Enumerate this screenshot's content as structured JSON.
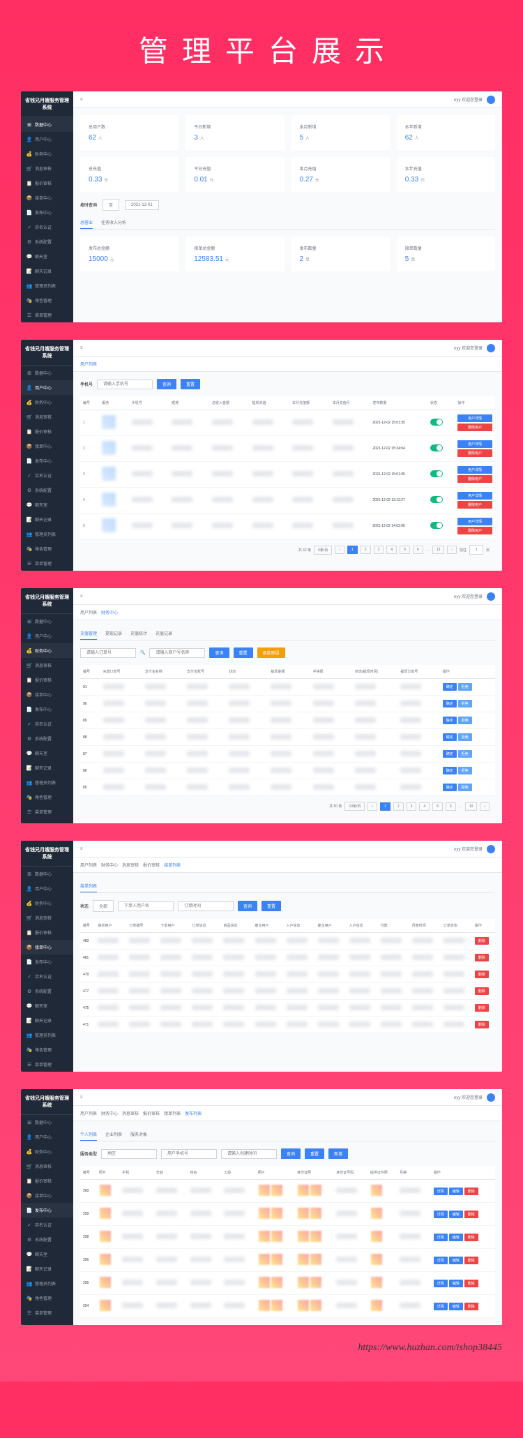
{
  "page_title": "管理平台展示",
  "app_title": "省钱兄月嫂服务管理系统",
  "welcome": "nyy 欢迎您登录",
  "menu_toggle": "≡",
  "sidebar": {
    "items": [
      {
        "icon": "⊞",
        "label": "数据中心"
      },
      {
        "icon": "👤",
        "label": "用户中心"
      },
      {
        "icon": "💰",
        "label": "财务中心"
      },
      {
        "icon": "🛒",
        "label": "消息审核"
      },
      {
        "icon": "📋",
        "label": "报价审核"
      },
      {
        "icon": "📦",
        "label": "接单中心"
      },
      {
        "icon": "📄",
        "label": "发布中心"
      },
      {
        "icon": "✓",
        "label": "实名认证"
      },
      {
        "icon": "⚙",
        "label": "系统配置"
      },
      {
        "icon": "💬",
        "label": "聊天室"
      },
      {
        "icon": "📝",
        "label": "聊天记录"
      },
      {
        "icon": "👥",
        "label": "管理员列表"
      },
      {
        "icon": "🎭",
        "label": "角色管理"
      },
      {
        "icon": "☰",
        "label": "菜单管理"
      }
    ]
  },
  "panel1": {
    "stats1": [
      {
        "label": "总用户数",
        "value": "62",
        "unit": "人"
      },
      {
        "label": "今日新增",
        "value": "3",
        "unit": "人"
      },
      {
        "label": "本月新增",
        "value": "5",
        "unit": "人"
      },
      {
        "label": "本年新增",
        "value": "62",
        "unit": "人"
      }
    ],
    "stats2": [
      {
        "label": "总充值",
        "value": "0.33",
        "unit": "元"
      },
      {
        "label": "今日充值",
        "value": "0.01",
        "unit": "元"
      },
      {
        "label": "本月充值",
        "value": "0.27",
        "unit": "元"
      },
      {
        "label": "本年充值",
        "value": "0.33",
        "unit": "元"
      }
    ],
    "date_label": "按时查询",
    "date_to": "至",
    "date_value": "2021-12-01",
    "tabs": [
      "总营业",
      "任务收入分析"
    ],
    "stats3": [
      {
        "label": "发布总金额",
        "value": "15000",
        "unit": "元"
      },
      {
        "label": "接单总金额",
        "value": "12583.51",
        "unit": "元"
      },
      {
        "label": "发布数量",
        "value": "2",
        "unit": "单"
      },
      {
        "label": "接单数量",
        "value": "5",
        "unit": "单"
      }
    ]
  },
  "panel2": {
    "crumbs": [
      "用户列表"
    ],
    "search_label": "手机号",
    "search_ph": "请输入手机号",
    "btn_search": "查询",
    "btn_reset": "重置",
    "cols": [
      "编号",
      "服务",
      "手机号",
      "昵称",
      "总收入金额",
      "提现充值",
      "本月充值额",
      "本月充值月",
      "发布数量",
      "状态",
      "操作"
    ],
    "rows": [
      {
        "time": "2021-12-02 15:01:35"
      },
      {
        "time": "2021-12-02 15:34:04"
      },
      {
        "time": "2021-12-02 15:01:35"
      },
      {
        "time": "2021-12-02 13:12:27"
      },
      {
        "time": "2021-12-02 14:02:06"
      }
    ],
    "btn_detail": "用户详情",
    "btn_delete": "删除用户",
    "page_total": "共 62 条",
    "page_size": "5条/页",
    "page_jump": "前往",
    "page_unit": "页"
  },
  "panel3": {
    "crumbs": [
      "用户列表",
      "财务中心"
    ],
    "tabs": [
      "充值管理",
      "提现记录",
      "充值统计",
      "充值记录"
    ],
    "search_ph1": "请输入订单号",
    "search_ph2": "请输入商户号名称",
    "btn_search": "查询",
    "btn_reset": "重置",
    "btn_extra": "退款原因",
    "cols": [
      "编号",
      "充值订单号",
      "支付宝名称",
      "支付宝账号",
      "状态",
      "提现金额",
      "手续费",
      "状态(提现时间)",
      "提现订单号",
      "操作"
    ],
    "btn_ok": "确定",
    "btn_no": "拒绝",
    "page_total": "共 50 条",
    "page_size": "10条/页"
  },
  "panel4": {
    "crumbs": [
      "用户列表",
      "财务中心",
      "消息审核",
      "报价审核",
      "接单列表"
    ],
    "filter_label": "状态",
    "filter_all": "全部",
    "search_ph": "下单人用户名",
    "date_ph": "订单时间",
    "btn_search": "查询",
    "btn_reset": "重置",
    "cols": [
      "编号",
      "接单用户",
      "订单编号",
      "下单用户",
      "订单信息",
      "商品信息",
      "雇主用户",
      "入户信息",
      "雇主用户",
      "入户信息",
      "付款",
      "月嫂时间",
      "订单状态",
      "操作"
    ],
    "rows": [
      "483",
      "481",
      "479",
      "477",
      "475",
      "471"
    ],
    "btn_del": "删除"
  },
  "panel5": {
    "crumbs": [
      "用户列表",
      "财务中心",
      "消息审核",
      "报价审核",
      "接单列表",
      "发布列表"
    ],
    "tabs": [
      "个人列表",
      "企业列表",
      "服务对象"
    ],
    "filter_label": "服务类型",
    "search_ph": "地区",
    "search_ph2": "用户手机号",
    "date_ph": "请输入创建时间",
    "btn_search": "查询",
    "btn_reset": "重置",
    "btn_new": "新增",
    "cols": [
      "编号",
      "照片",
      "手机",
      "年龄",
      "姓名",
      "工龄",
      "照片",
      "身份证照",
      "身份证号码",
      "提供证件照",
      "月薪",
      "操作"
    ],
    "rows": [
      "260",
      "259",
      "258",
      "256",
      "255",
      "254"
    ],
    "btn_a": "详情",
    "btn_b": "编辑",
    "btn_c": "删除"
  },
  "footer_url": "https://www.huzhan.com/ishop38445"
}
